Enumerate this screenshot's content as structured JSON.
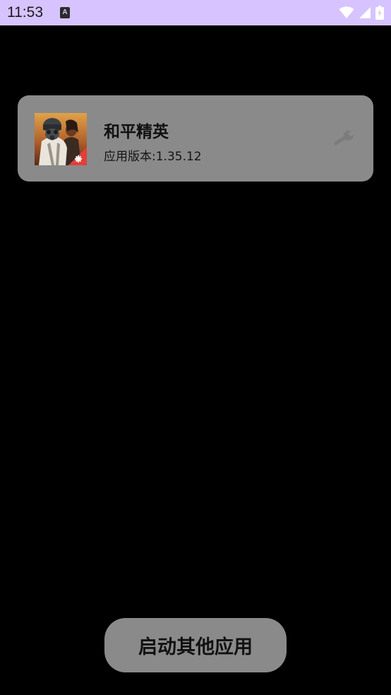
{
  "status_bar": {
    "time": "11:53",
    "notification_letter": "A",
    "background": "#d7c3ff",
    "icons": [
      "wifi-icon",
      "signal-icon",
      "battery-charging-icon"
    ]
  },
  "app_card": {
    "name": "和平精英",
    "version_label": "应用版本:",
    "version_value": "1.35.12",
    "icon": "game-app-icon",
    "settings_icon": "wrench-icon",
    "background": "#8a8a8a"
  },
  "launch_button": {
    "label": "启动其他应用",
    "background": "#8a8a8a"
  }
}
